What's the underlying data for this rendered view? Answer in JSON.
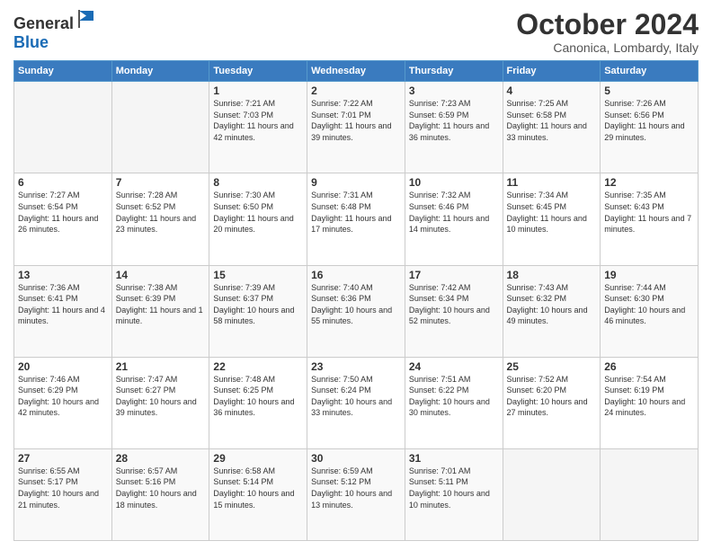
{
  "logo": {
    "line1": "General",
    "line2": "Blue"
  },
  "title": "October 2024",
  "location": "Canonica, Lombardy, Italy",
  "weekdays": [
    "Sunday",
    "Monday",
    "Tuesday",
    "Wednesday",
    "Thursday",
    "Friday",
    "Saturday"
  ],
  "weeks": [
    [
      {
        "day": "",
        "info": ""
      },
      {
        "day": "",
        "info": ""
      },
      {
        "day": "1",
        "info": "Sunrise: 7:21 AM\nSunset: 7:03 PM\nDaylight: 11 hours and 42 minutes."
      },
      {
        "day": "2",
        "info": "Sunrise: 7:22 AM\nSunset: 7:01 PM\nDaylight: 11 hours and 39 minutes."
      },
      {
        "day": "3",
        "info": "Sunrise: 7:23 AM\nSunset: 6:59 PM\nDaylight: 11 hours and 36 minutes."
      },
      {
        "day": "4",
        "info": "Sunrise: 7:25 AM\nSunset: 6:58 PM\nDaylight: 11 hours and 33 minutes."
      },
      {
        "day": "5",
        "info": "Sunrise: 7:26 AM\nSunset: 6:56 PM\nDaylight: 11 hours and 29 minutes."
      }
    ],
    [
      {
        "day": "6",
        "info": "Sunrise: 7:27 AM\nSunset: 6:54 PM\nDaylight: 11 hours and 26 minutes."
      },
      {
        "day": "7",
        "info": "Sunrise: 7:28 AM\nSunset: 6:52 PM\nDaylight: 11 hours and 23 minutes."
      },
      {
        "day": "8",
        "info": "Sunrise: 7:30 AM\nSunset: 6:50 PM\nDaylight: 11 hours and 20 minutes."
      },
      {
        "day": "9",
        "info": "Sunrise: 7:31 AM\nSunset: 6:48 PM\nDaylight: 11 hours and 17 minutes."
      },
      {
        "day": "10",
        "info": "Sunrise: 7:32 AM\nSunset: 6:46 PM\nDaylight: 11 hours and 14 minutes."
      },
      {
        "day": "11",
        "info": "Sunrise: 7:34 AM\nSunset: 6:45 PM\nDaylight: 11 hours and 10 minutes."
      },
      {
        "day": "12",
        "info": "Sunrise: 7:35 AM\nSunset: 6:43 PM\nDaylight: 11 hours and 7 minutes."
      }
    ],
    [
      {
        "day": "13",
        "info": "Sunrise: 7:36 AM\nSunset: 6:41 PM\nDaylight: 11 hours and 4 minutes."
      },
      {
        "day": "14",
        "info": "Sunrise: 7:38 AM\nSunset: 6:39 PM\nDaylight: 11 hours and 1 minute."
      },
      {
        "day": "15",
        "info": "Sunrise: 7:39 AM\nSunset: 6:37 PM\nDaylight: 10 hours and 58 minutes."
      },
      {
        "day": "16",
        "info": "Sunrise: 7:40 AM\nSunset: 6:36 PM\nDaylight: 10 hours and 55 minutes."
      },
      {
        "day": "17",
        "info": "Sunrise: 7:42 AM\nSunset: 6:34 PM\nDaylight: 10 hours and 52 minutes."
      },
      {
        "day": "18",
        "info": "Sunrise: 7:43 AM\nSunset: 6:32 PM\nDaylight: 10 hours and 49 minutes."
      },
      {
        "day": "19",
        "info": "Sunrise: 7:44 AM\nSunset: 6:30 PM\nDaylight: 10 hours and 46 minutes."
      }
    ],
    [
      {
        "day": "20",
        "info": "Sunrise: 7:46 AM\nSunset: 6:29 PM\nDaylight: 10 hours and 42 minutes."
      },
      {
        "day": "21",
        "info": "Sunrise: 7:47 AM\nSunset: 6:27 PM\nDaylight: 10 hours and 39 minutes."
      },
      {
        "day": "22",
        "info": "Sunrise: 7:48 AM\nSunset: 6:25 PM\nDaylight: 10 hours and 36 minutes."
      },
      {
        "day": "23",
        "info": "Sunrise: 7:50 AM\nSunset: 6:24 PM\nDaylight: 10 hours and 33 minutes."
      },
      {
        "day": "24",
        "info": "Sunrise: 7:51 AM\nSunset: 6:22 PM\nDaylight: 10 hours and 30 minutes."
      },
      {
        "day": "25",
        "info": "Sunrise: 7:52 AM\nSunset: 6:20 PM\nDaylight: 10 hours and 27 minutes."
      },
      {
        "day": "26",
        "info": "Sunrise: 7:54 AM\nSunset: 6:19 PM\nDaylight: 10 hours and 24 minutes."
      }
    ],
    [
      {
        "day": "27",
        "info": "Sunrise: 6:55 AM\nSunset: 5:17 PM\nDaylight: 10 hours and 21 minutes."
      },
      {
        "day": "28",
        "info": "Sunrise: 6:57 AM\nSunset: 5:16 PM\nDaylight: 10 hours and 18 minutes."
      },
      {
        "day": "29",
        "info": "Sunrise: 6:58 AM\nSunset: 5:14 PM\nDaylight: 10 hours and 15 minutes."
      },
      {
        "day": "30",
        "info": "Sunrise: 6:59 AM\nSunset: 5:12 PM\nDaylight: 10 hours and 13 minutes."
      },
      {
        "day": "31",
        "info": "Sunrise: 7:01 AM\nSunset: 5:11 PM\nDaylight: 10 hours and 10 minutes."
      },
      {
        "day": "",
        "info": ""
      },
      {
        "day": "",
        "info": ""
      }
    ]
  ]
}
